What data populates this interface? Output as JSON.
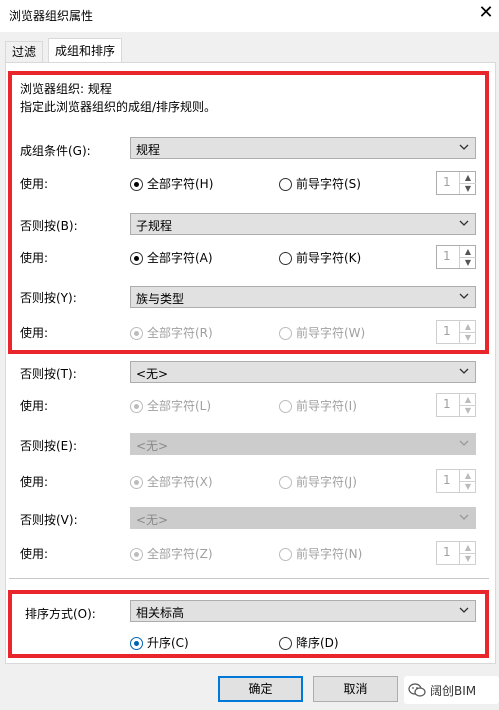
{
  "window": {
    "title": "浏览器组织属性"
  },
  "tabs": [
    {
      "label": "过滤"
    },
    {
      "label": "成组和排序"
    }
  ],
  "header": {
    "org_label": "浏览器组织: 规程",
    "description": "指定此浏览器组织的成组/排序规则。"
  },
  "group_by": {
    "label": "成组条件(G):",
    "value": "规程",
    "use_label": "使用:",
    "all_chars": "全部字符(H)",
    "leading_chars": "前导字符(S)",
    "count": "1",
    "selected": "all"
  },
  "then_by_b": {
    "label": "否则按(B):",
    "value": "子规程",
    "use_label": "使用:",
    "all_chars": "全部字符(A)",
    "leading_chars": "前导字符(K)",
    "count": "1",
    "selected": "all"
  },
  "then_by_y": {
    "label": "否则按(Y):",
    "value": "族与类型",
    "use_label": "使用:",
    "all_chars": "全部字符(R)",
    "leading_chars": "前导字符(W)",
    "count": "1",
    "selected": "all"
  },
  "then_by_t": {
    "label": "否则按(T):",
    "value": "<无>",
    "use_label": "使用:",
    "all_chars": "全部字符(L)",
    "leading_chars": "前导字符(I)",
    "count": "1"
  },
  "then_by_e": {
    "label": "否则按(E):",
    "value": "<无>",
    "use_label": "使用:",
    "all_chars": "全部字符(X)",
    "leading_chars": "前导字符(J)",
    "count": "1"
  },
  "then_by_v": {
    "label": "否则按(V):",
    "value": "<无>",
    "use_label": "使用:",
    "all_chars": "全部字符(Z)",
    "leading_chars": "前导字符(N)",
    "count": "1"
  },
  "sort": {
    "label": "排序方式(O):",
    "value": "相关标高",
    "ascending": "升序(C)",
    "descending": "降序(D)",
    "selected": "ascending"
  },
  "buttons": {
    "ok": "确定",
    "cancel": "取消"
  },
  "watermark": {
    "text": "阔创BIM"
  },
  "colors": {
    "highlight_frame": "#e8262b",
    "accent": "#0078d7"
  }
}
